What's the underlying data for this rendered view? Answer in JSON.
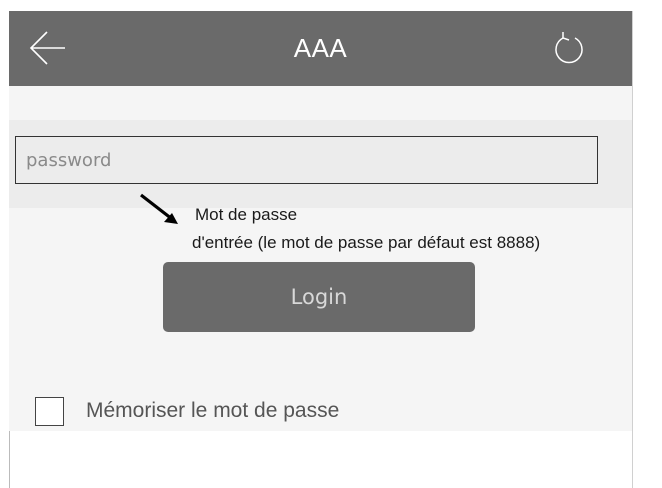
{
  "titlebar": {
    "title": "AAA",
    "back_icon": "arrow-left-icon",
    "refresh_icon": "refresh-icon",
    "background": "#6a6a6a"
  },
  "login_form": {
    "password_placeholder": "password",
    "login_label": "Login",
    "remember_label": "Mémoriser le mot de passe",
    "remember_checked": false
  },
  "annotation": {
    "line1": "Mot de passe",
    "line2": "d'entrée (le mot de passe par défaut est 8888)"
  }
}
